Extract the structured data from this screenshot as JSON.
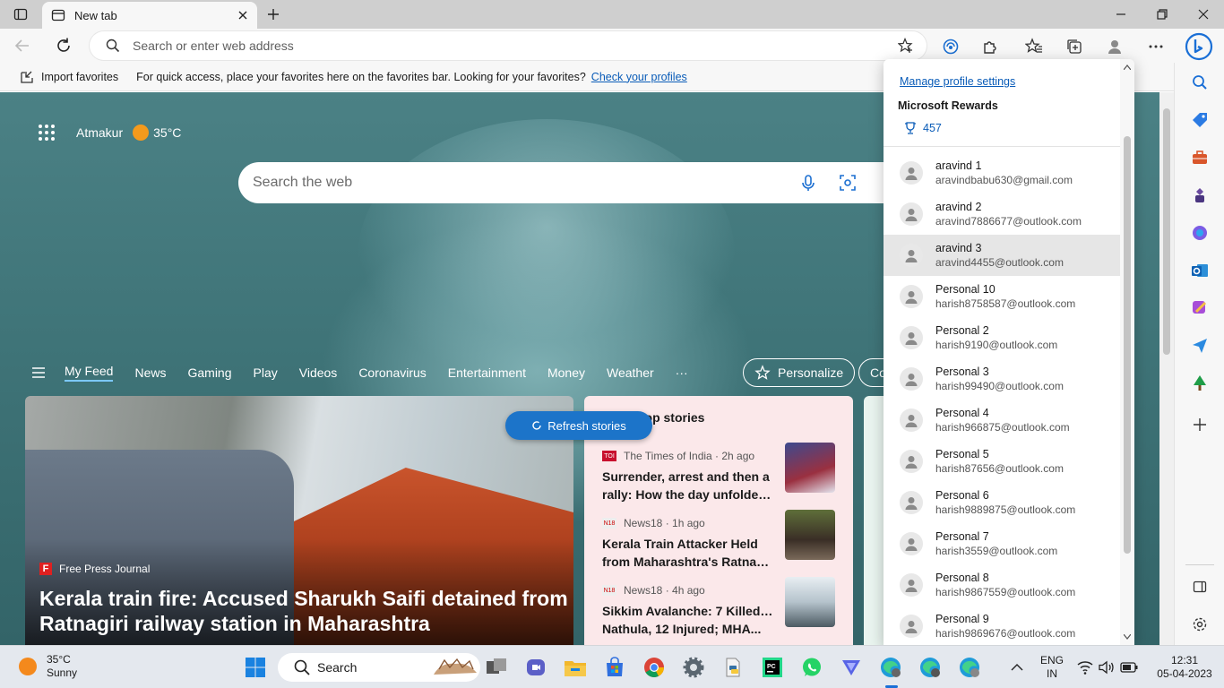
{
  "browser": {
    "tab_title": "New tab",
    "address_placeholder": "Search or enter web address"
  },
  "favorites_bar": {
    "import_label": "Import favorites",
    "message": "For quick access, place your favorites here on the favorites bar. Looking for your favorites?",
    "link": "Check your profiles"
  },
  "newtab": {
    "location": "Atmakur",
    "temperature": "35°C",
    "search_placeholder": "Search the web",
    "nav": [
      "My Feed",
      "News",
      "Gaming",
      "Play",
      "Videos",
      "Coronavirus",
      "Entertainment",
      "Money",
      "Weather",
      "···"
    ],
    "personalize_label": "Personalize",
    "next_pill_label": "Co",
    "refresh_label": "Refresh stories",
    "hero": {
      "source": "Free Press Journal",
      "source_logo": "F",
      "headline": "Kerala train fire: Accused Sharukh Saifi detained from Ratnagiri railway station in Maharashtra"
    },
    "top_stories": {
      "title": "Top stories",
      "items": [
        {
          "badge": "TOI",
          "source": "The Times of India · 2h ago",
          "line1": "Surrender, arrest and then a",
          "line2": "rally: How the day unfolded..."
        },
        {
          "badge": "N18",
          "source": "News18 · 1h ago",
          "line1": "Kerala Train Attacker Held",
          "line2": "from Maharashtra's Ratnagi..."
        },
        {
          "badge": "N18",
          "source": "News18 · 4h ago",
          "line1": "Sikkim Avalanche: 7 Killed in",
          "line2": "Nathula, 12 Injured; MHA..."
        }
      ]
    }
  },
  "profile_menu": {
    "manage_link": "Manage profile settings",
    "rewards_title": "Microsoft Rewards",
    "rewards_points": "457",
    "profiles": [
      {
        "name": "aravind 1",
        "email": "aravindbabu630@gmail.com",
        "selected": false
      },
      {
        "name": "aravind 2",
        "email": "aravind7886677@outlook.com",
        "selected": false
      },
      {
        "name": "aravind 3",
        "email": "aravind4455@outlook.com",
        "selected": true
      },
      {
        "name": "Personal 10",
        "email": "harish8758587@outlook.com",
        "selected": false
      },
      {
        "name": "Personal 2",
        "email": "harish9190@outlook.com",
        "selected": false
      },
      {
        "name": "Personal 3",
        "email": "harish99490@outlook.com",
        "selected": false
      },
      {
        "name": "Personal 4",
        "email": "harish966875@outlook.com",
        "selected": false
      },
      {
        "name": "Personal 5",
        "email": "harish87656@outlook.com",
        "selected": false
      },
      {
        "name": "Personal 6",
        "email": "harish9889875@outlook.com",
        "selected": false
      },
      {
        "name": "Personal 7",
        "email": "harish3559@outlook.com",
        "selected": false
      },
      {
        "name": "Personal 8",
        "email": "harish9867559@outlook.com",
        "selected": false
      },
      {
        "name": "Personal 9",
        "email": "harish9869676@outlook.com",
        "selected": false
      }
    ]
  },
  "taskbar": {
    "weather_temp": "35°C",
    "weather_desc": "Sunny",
    "search_label": "Search",
    "lang_top": "ENG",
    "lang_bottom": "IN",
    "time": "12:31",
    "date": "05-04-2023"
  },
  "colors": {
    "accent": "#1c74c9",
    "link": "#0a5cb8",
    "titlebar": "#cfcfcf",
    "taskbar": "#e4e8ee"
  }
}
